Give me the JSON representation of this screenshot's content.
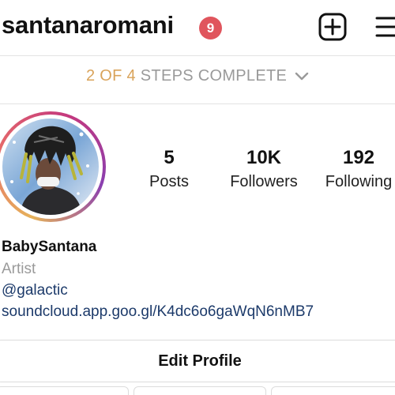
{
  "header": {
    "username": "santanaromani",
    "notification_count": "9",
    "new_post_icon": "plus-square-icon",
    "menu_icon": "hamburger-menu-icon",
    "badge_color": "#e0555d"
  },
  "steps_banner": {
    "progress": "2 OF 4",
    "label": "STEPS COMPLETE",
    "icon": "chevron-down-icon",
    "progress_color": "#d9a35a"
  },
  "profile": {
    "avatar_icon": "avatar",
    "stats": [
      {
        "value": "5",
        "label": "Posts"
      },
      {
        "value": "10K",
        "label": "Followers"
      },
      {
        "value": "192",
        "label": "Following"
      }
    ],
    "display_name": "BabySantana",
    "category": "Artist",
    "mention": "@galactic",
    "link": "soundcloud.app.goo.gl/K4dc6o6gaWqN6nMB7"
  },
  "actions": {
    "edit_profile_label": "Edit Profile"
  }
}
